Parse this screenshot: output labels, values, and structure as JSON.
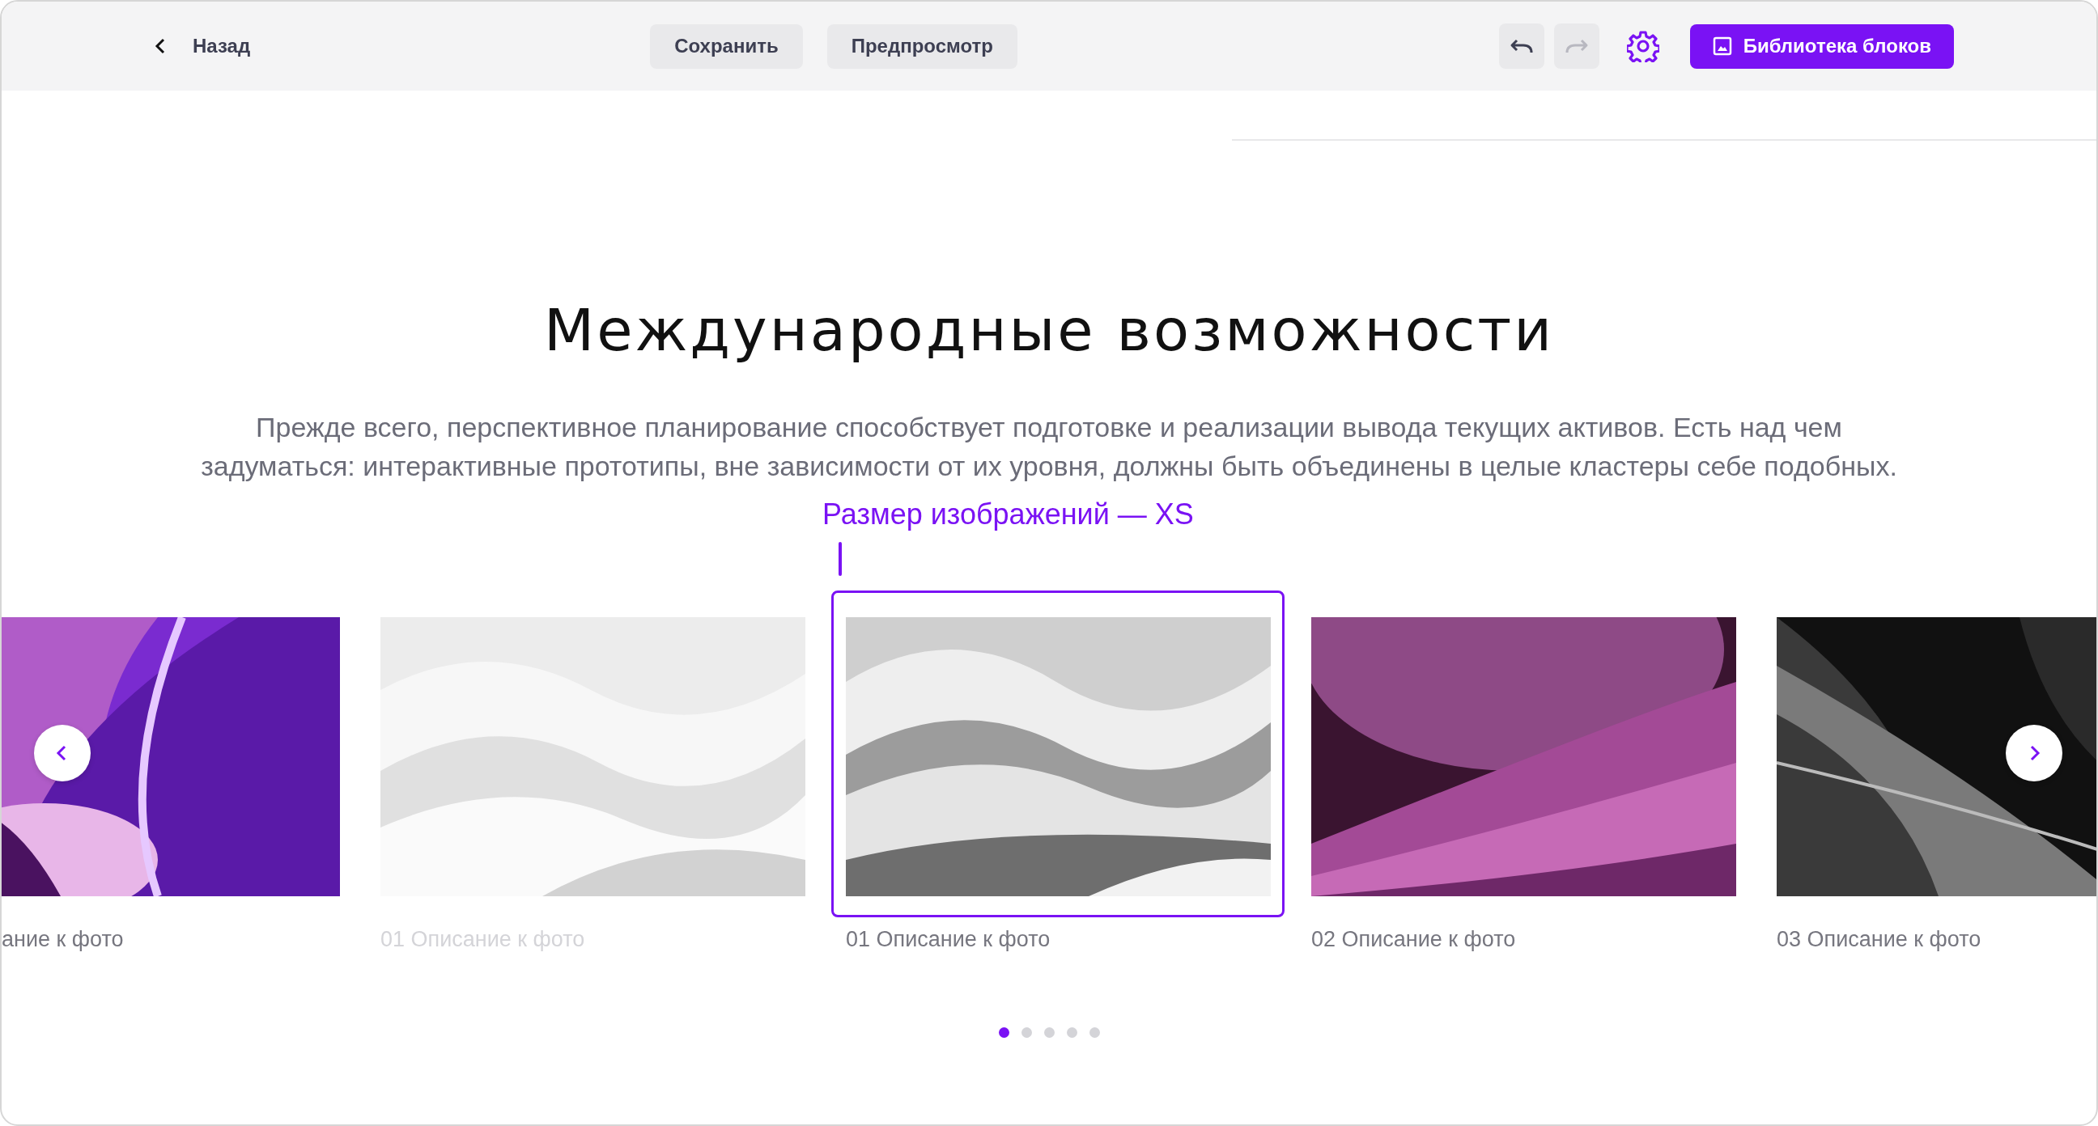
{
  "toolbar": {
    "back_label": "Назад",
    "buttons": [
      {
        "label": "Сохранить"
      },
      {
        "label": "Предпросмотр"
      }
    ],
    "history": [
      {
        "kind": "undo",
        "disabled": false
      },
      {
        "kind": "redo",
        "disabled": true
      }
    ],
    "library_button": {
      "label": "Библиотека блоков"
    }
  },
  "section": {
    "title": "Международные возможности",
    "description": "Прежде всего, перспективное планирование способствует подготовке и реализации вывода текущих активов. Есть над чем задуматься: интерактивные прототипы, вне зависимости от их уровня, должны быть объединены в целые кластеры себе подобных."
  },
  "annotation": {
    "label": "Размер изображений — XS"
  },
  "slides": [
    {
      "kind": "picture",
      "caption": "ание к фото",
      "selected": false,
      "dimmed": false
    },
    {
      "kind": "picture",
      "caption": "01 Описание к фото",
      "selected": false,
      "dimmed": true
    },
    {
      "kind": "picture",
      "caption": "01 Описание к фото",
      "selected": true,
      "dimmed": false
    },
    {
      "kind": "picture",
      "caption": "02 Описание к фото",
      "selected": false,
      "dimmed": false
    },
    {
      "kind": "picture",
      "caption": "03 Описание к фото",
      "selected": false,
      "dimmed": false
    }
  ],
  "pagination": [
    {
      "selected": true
    },
    {
      "selected": false
    },
    {
      "selected": false
    },
    {
      "selected": false
    },
    {
      "selected": false
    }
  ]
}
